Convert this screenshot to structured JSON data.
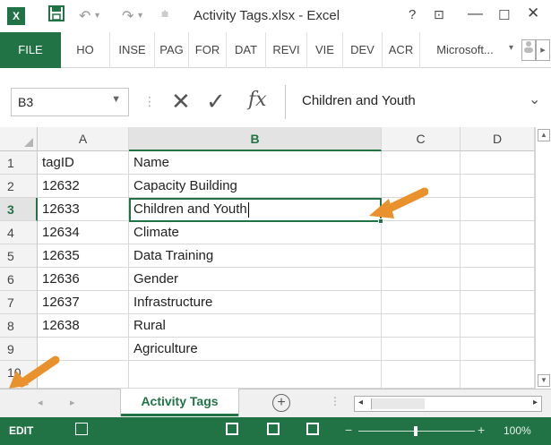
{
  "window": {
    "title": "Activity Tags.xlsx - Excel",
    "controls": {
      "help": "?",
      "restore": "⊡",
      "minimize": "—",
      "maximize": "☐",
      "close": "✕"
    }
  },
  "quick_access": {
    "app_icon_label": "X",
    "save_icon": "save-icon",
    "undo_icon": "undo-icon",
    "redo_icon": "redo-icon"
  },
  "ribbon": {
    "tabs": [
      "FILE",
      "HO",
      "INSE",
      "PAG",
      "FOR",
      "DAT",
      "REVI",
      "VIE",
      "DEV",
      "ACR",
      "Microsoft..."
    ],
    "ms_dropdown": "▾"
  },
  "formula_bar": {
    "name_box": "B3",
    "content": "Children and Youth"
  },
  "sheet": {
    "columns": [
      "A",
      "B",
      "C",
      "D"
    ],
    "selected_column": "B",
    "rows": [
      {
        "num": "1",
        "A": "tagID",
        "B": "Name"
      },
      {
        "num": "2",
        "A": "12632",
        "B": "Capacity Building"
      },
      {
        "num": "3",
        "A": "12633",
        "B": "Children and Youth"
      },
      {
        "num": "4",
        "A": "12634",
        "B": "Climate"
      },
      {
        "num": "5",
        "A": "12635",
        "B": "Data Training"
      },
      {
        "num": "6",
        "A": "12636",
        "B": "Gender"
      },
      {
        "num": "7",
        "A": "12637",
        "B": "Infrastructure"
      },
      {
        "num": "8",
        "A": "12638",
        "B": "Rural"
      },
      {
        "num": "9",
        "A": "",
        "B": "Agriculture"
      },
      {
        "num": "10",
        "A": "",
        "B": ""
      }
    ],
    "active_row": "3"
  },
  "sheet_tabs": {
    "active": "Activity Tags",
    "add": "+"
  },
  "status": {
    "mode": "EDIT",
    "zoom": "100%"
  },
  "colors": {
    "accent": "#217346",
    "annotation_arrow": "#E8912D"
  }
}
